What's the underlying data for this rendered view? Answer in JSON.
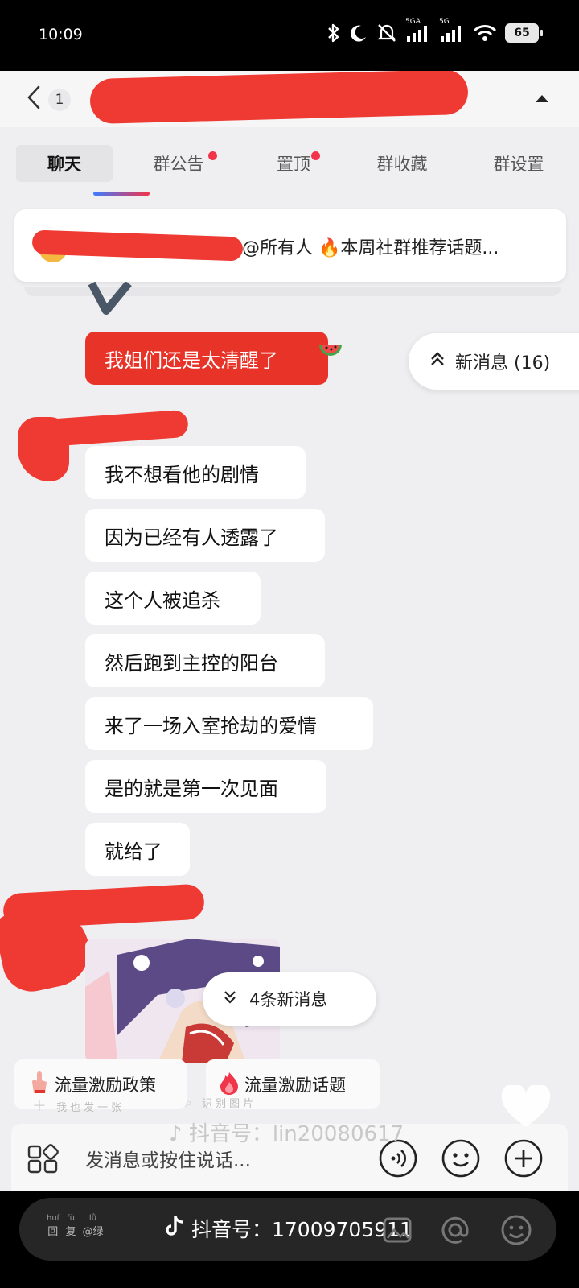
{
  "status_bar": {
    "time": "10:09",
    "network1": "5GA",
    "network2": "5G",
    "battery": "65"
  },
  "nav": {
    "back_count": "1"
  },
  "tabs": [
    {
      "label": "聊天",
      "active": true,
      "dot": false
    },
    {
      "label": "群公告",
      "active": false,
      "dot": true
    },
    {
      "label": "置顶",
      "active": false,
      "dot": true
    },
    {
      "label": "群收藏",
      "active": false,
      "dot": false
    },
    {
      "label": "群设置",
      "active": false,
      "dot": false
    }
  ],
  "notice": {
    "text": "@所有人 🔥本周社群推荐话题..."
  },
  "messages": {
    "red_message": "我姐们还是太清醒了",
    "list": [
      "我不想看他的剧情",
      "因为已经有人透露了",
      "这个人被追杀",
      "然后跑到主控的阳台",
      "来了一场入室抢劫的爱情",
      "是的就是第一次见面",
      "就给了"
    ]
  },
  "new_messages_pill": "新消息 (16)",
  "new_below_pill": "4条新消息",
  "chips": [
    {
      "label": "流量激励政策",
      "icon": "hand-icon"
    },
    {
      "label": "流量激励话题",
      "icon": "flame-icon"
    }
  ],
  "overlay_hints": {
    "left": "我也发一张",
    "right": "识别图片"
  },
  "watermark": "抖音号：lin20080617",
  "input": {
    "placeholder": "发消息或按住说话..."
  },
  "bottom_bar": {
    "small_chars": [
      {
        "pinyin": "huí",
        "char": "回"
      },
      {
        "pinyin": "fù",
        "char": "复"
      },
      {
        "pinyin": "lǜ",
        "char": "@绿"
      }
    ],
    "douyin_id": "抖音号：17009705911"
  },
  "colors": {
    "accent_red": "#e83328",
    "badge_red": "#f2334a",
    "background": "#efeff1"
  }
}
